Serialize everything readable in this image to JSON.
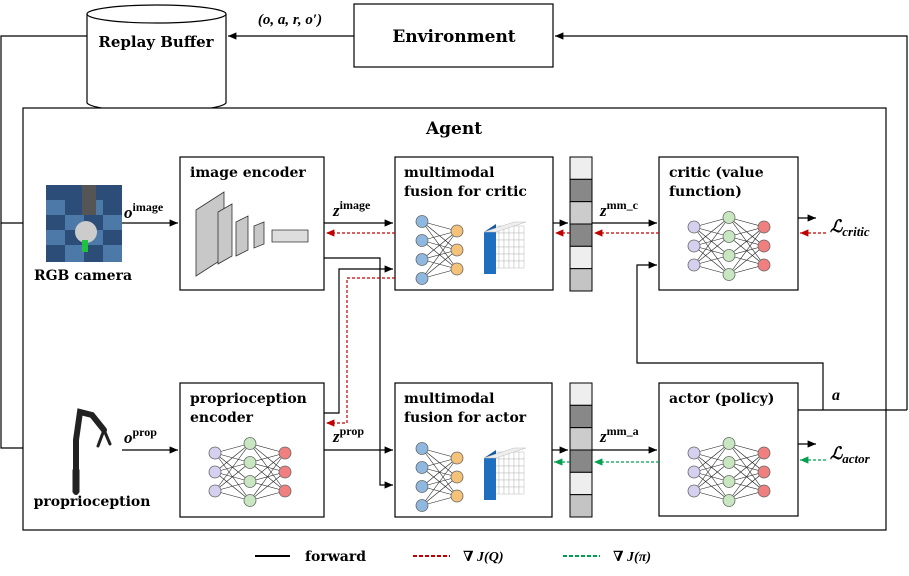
{
  "replay_buffer": {
    "label": "Replay Buffer"
  },
  "environment": {
    "label": "Environment"
  },
  "transition": {
    "label": "(o, a, r, o′)"
  },
  "agent": {
    "title": "Agent"
  },
  "image_encoder": {
    "line1": "image encoder"
  },
  "fusion_critic": {
    "line1": "multimodal",
    "line2": "fusion for critic"
  },
  "critic": {
    "line1": "critic (value",
    "line2": "function)"
  },
  "rgb_camera": {
    "label": "RGB camera"
  },
  "prop_encoder": {
    "line1": "proprioception",
    "line2": "encoder"
  },
  "fusion_actor": {
    "line1": "multimodal",
    "line2": "fusion for actor"
  },
  "actor": {
    "line1": "actor (policy)"
  },
  "proprioception": {
    "label": "proprioception"
  },
  "symbols": {
    "o": "o",
    "image": "image",
    "z": "z",
    "mm_c": "mm_c",
    "mm_a": "mm_a",
    "prop": "prop",
    "L": "ℒ",
    "critic": "critic",
    "actor": "actor",
    "a": "a"
  },
  "legend": {
    "forward": "forward",
    "grad_q": "∇ J(Q)",
    "grad_pi": "∇ J(π)"
  },
  "colors": {
    "red_grad": "#c00000",
    "green_grad": "#00a050",
    "node_blue": "#8fb8e0",
    "node_orange": "#f5c27a",
    "node_purple": "#d5d0f0",
    "node_green": "#c8e6c0",
    "node_red": "#f08080",
    "cube_blue": "#1f6fc0"
  }
}
